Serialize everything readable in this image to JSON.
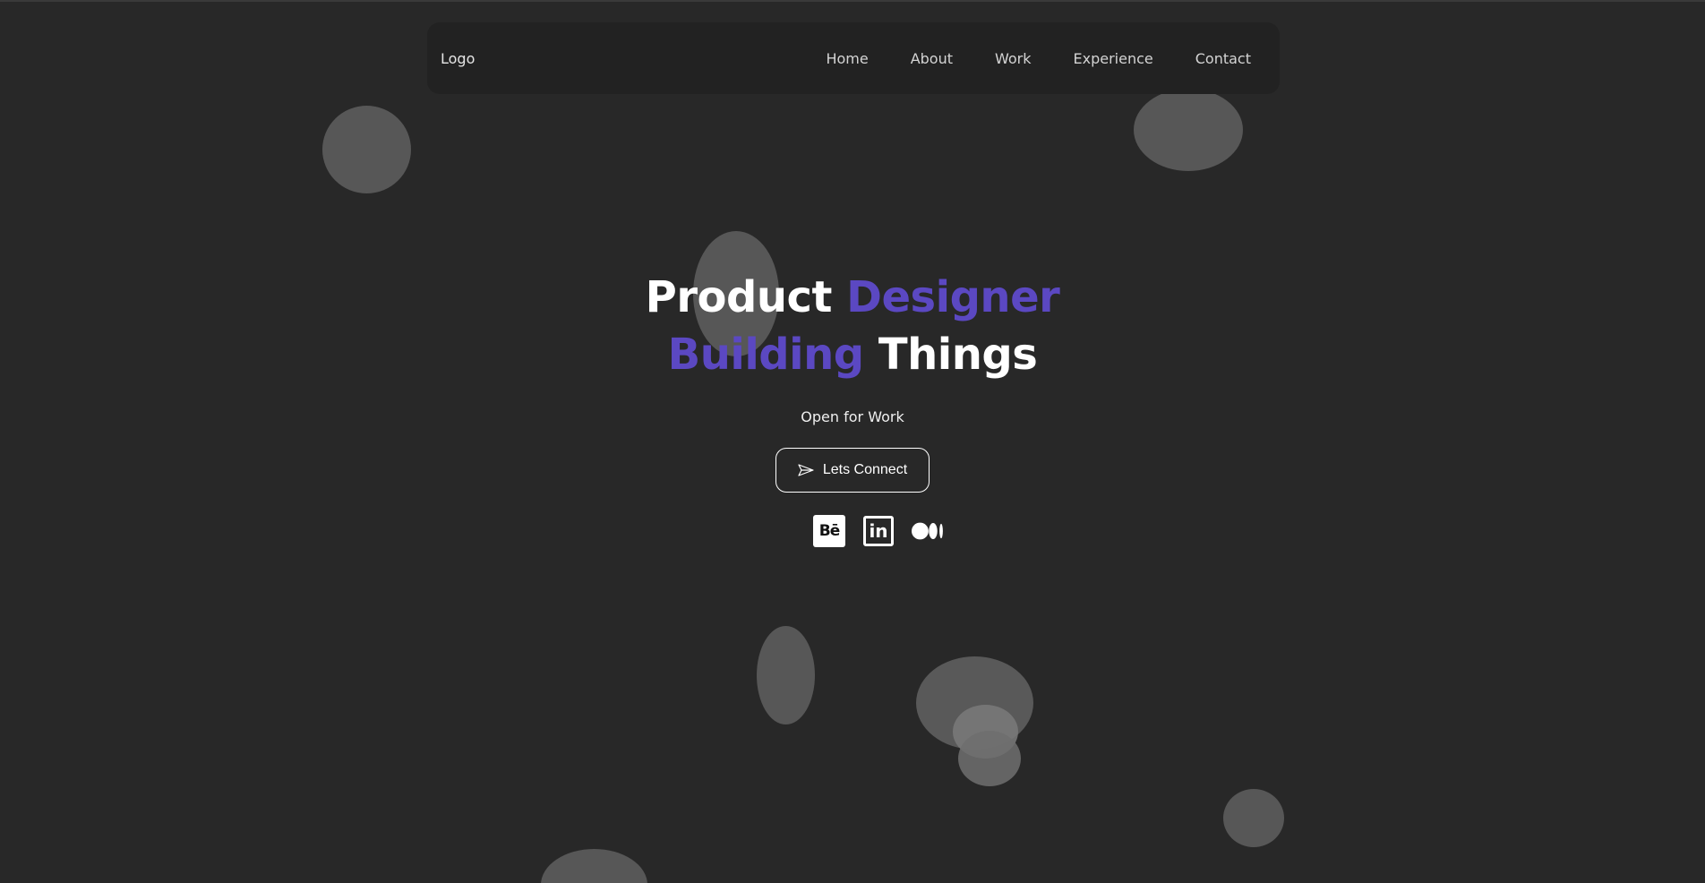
{
  "nav": {
    "logo": "Logo",
    "links": [
      "Home",
      "About",
      "Work",
      "Experience",
      "Contact"
    ]
  },
  "hero": {
    "line1_a": "Product",
    "line1_b": "Designer",
    "line2_a": "Building",
    "line2_b": "Things",
    "subtitle": "Open for Work",
    "cta_label": "Lets Connect"
  },
  "socials": {
    "behance": "Bē",
    "linkedin": "in"
  },
  "colors": {
    "background": "#282828",
    "accent": "#5b48c2",
    "navbar": "#222222"
  },
  "icons": [
    "send-icon",
    "behance-icon",
    "linkedin-icon",
    "medium-icon"
  ]
}
